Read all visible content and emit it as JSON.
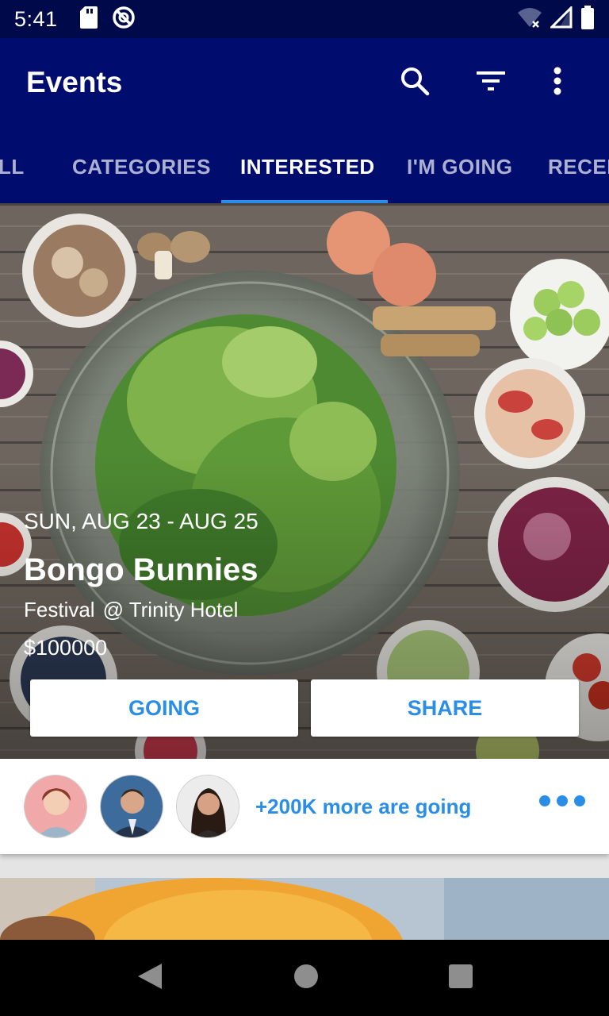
{
  "status_bar": {
    "time": "5:41"
  },
  "app_bar": {
    "title": "Events"
  },
  "tabs": [
    {
      "label": "ALL",
      "visible_text": "LL"
    },
    {
      "label": "CATEGORIES"
    },
    {
      "label": "INTERESTED",
      "active": true
    },
    {
      "label": "I'M GOING"
    },
    {
      "label": "RECEN"
    }
  ],
  "event": {
    "date": "SUN, AUG 23 - AUG 25",
    "title": "Bongo Bunnies",
    "category": "Festival",
    "venue": "@ Trinity Hotel",
    "price": "$100000",
    "going_label": "GOING",
    "share_label": "SHARE",
    "attendees_text": "+200K more are going"
  },
  "colors": {
    "primary": "#000c6e",
    "status_bar": "#000a4a",
    "accent": "#2a8ee6"
  }
}
